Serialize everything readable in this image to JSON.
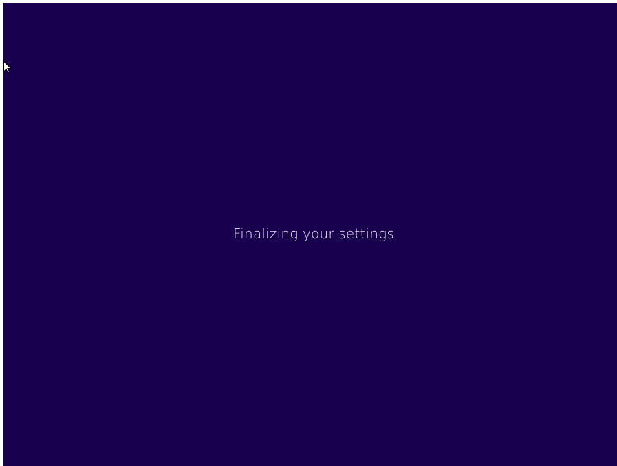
{
  "screen": {
    "status_text": "Finalizing your settings",
    "background_color": "#18004e",
    "text_color": "#e6e2f2"
  },
  "cursor": {
    "icon": "mouse-pointer-icon"
  }
}
